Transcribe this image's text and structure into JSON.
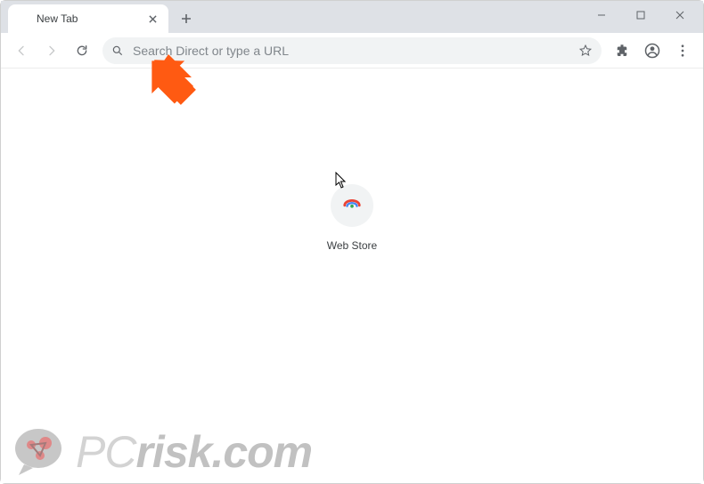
{
  "tab": {
    "title": "New Tab"
  },
  "omnibox": {
    "placeholder": "Search Direct or type a URL"
  },
  "shortcuts": [
    {
      "label": "Web Store"
    }
  ],
  "watermark": {
    "text_light": "PC",
    "text_dark": "risk.com"
  },
  "accent": {
    "arrow": "#ff5a12"
  }
}
